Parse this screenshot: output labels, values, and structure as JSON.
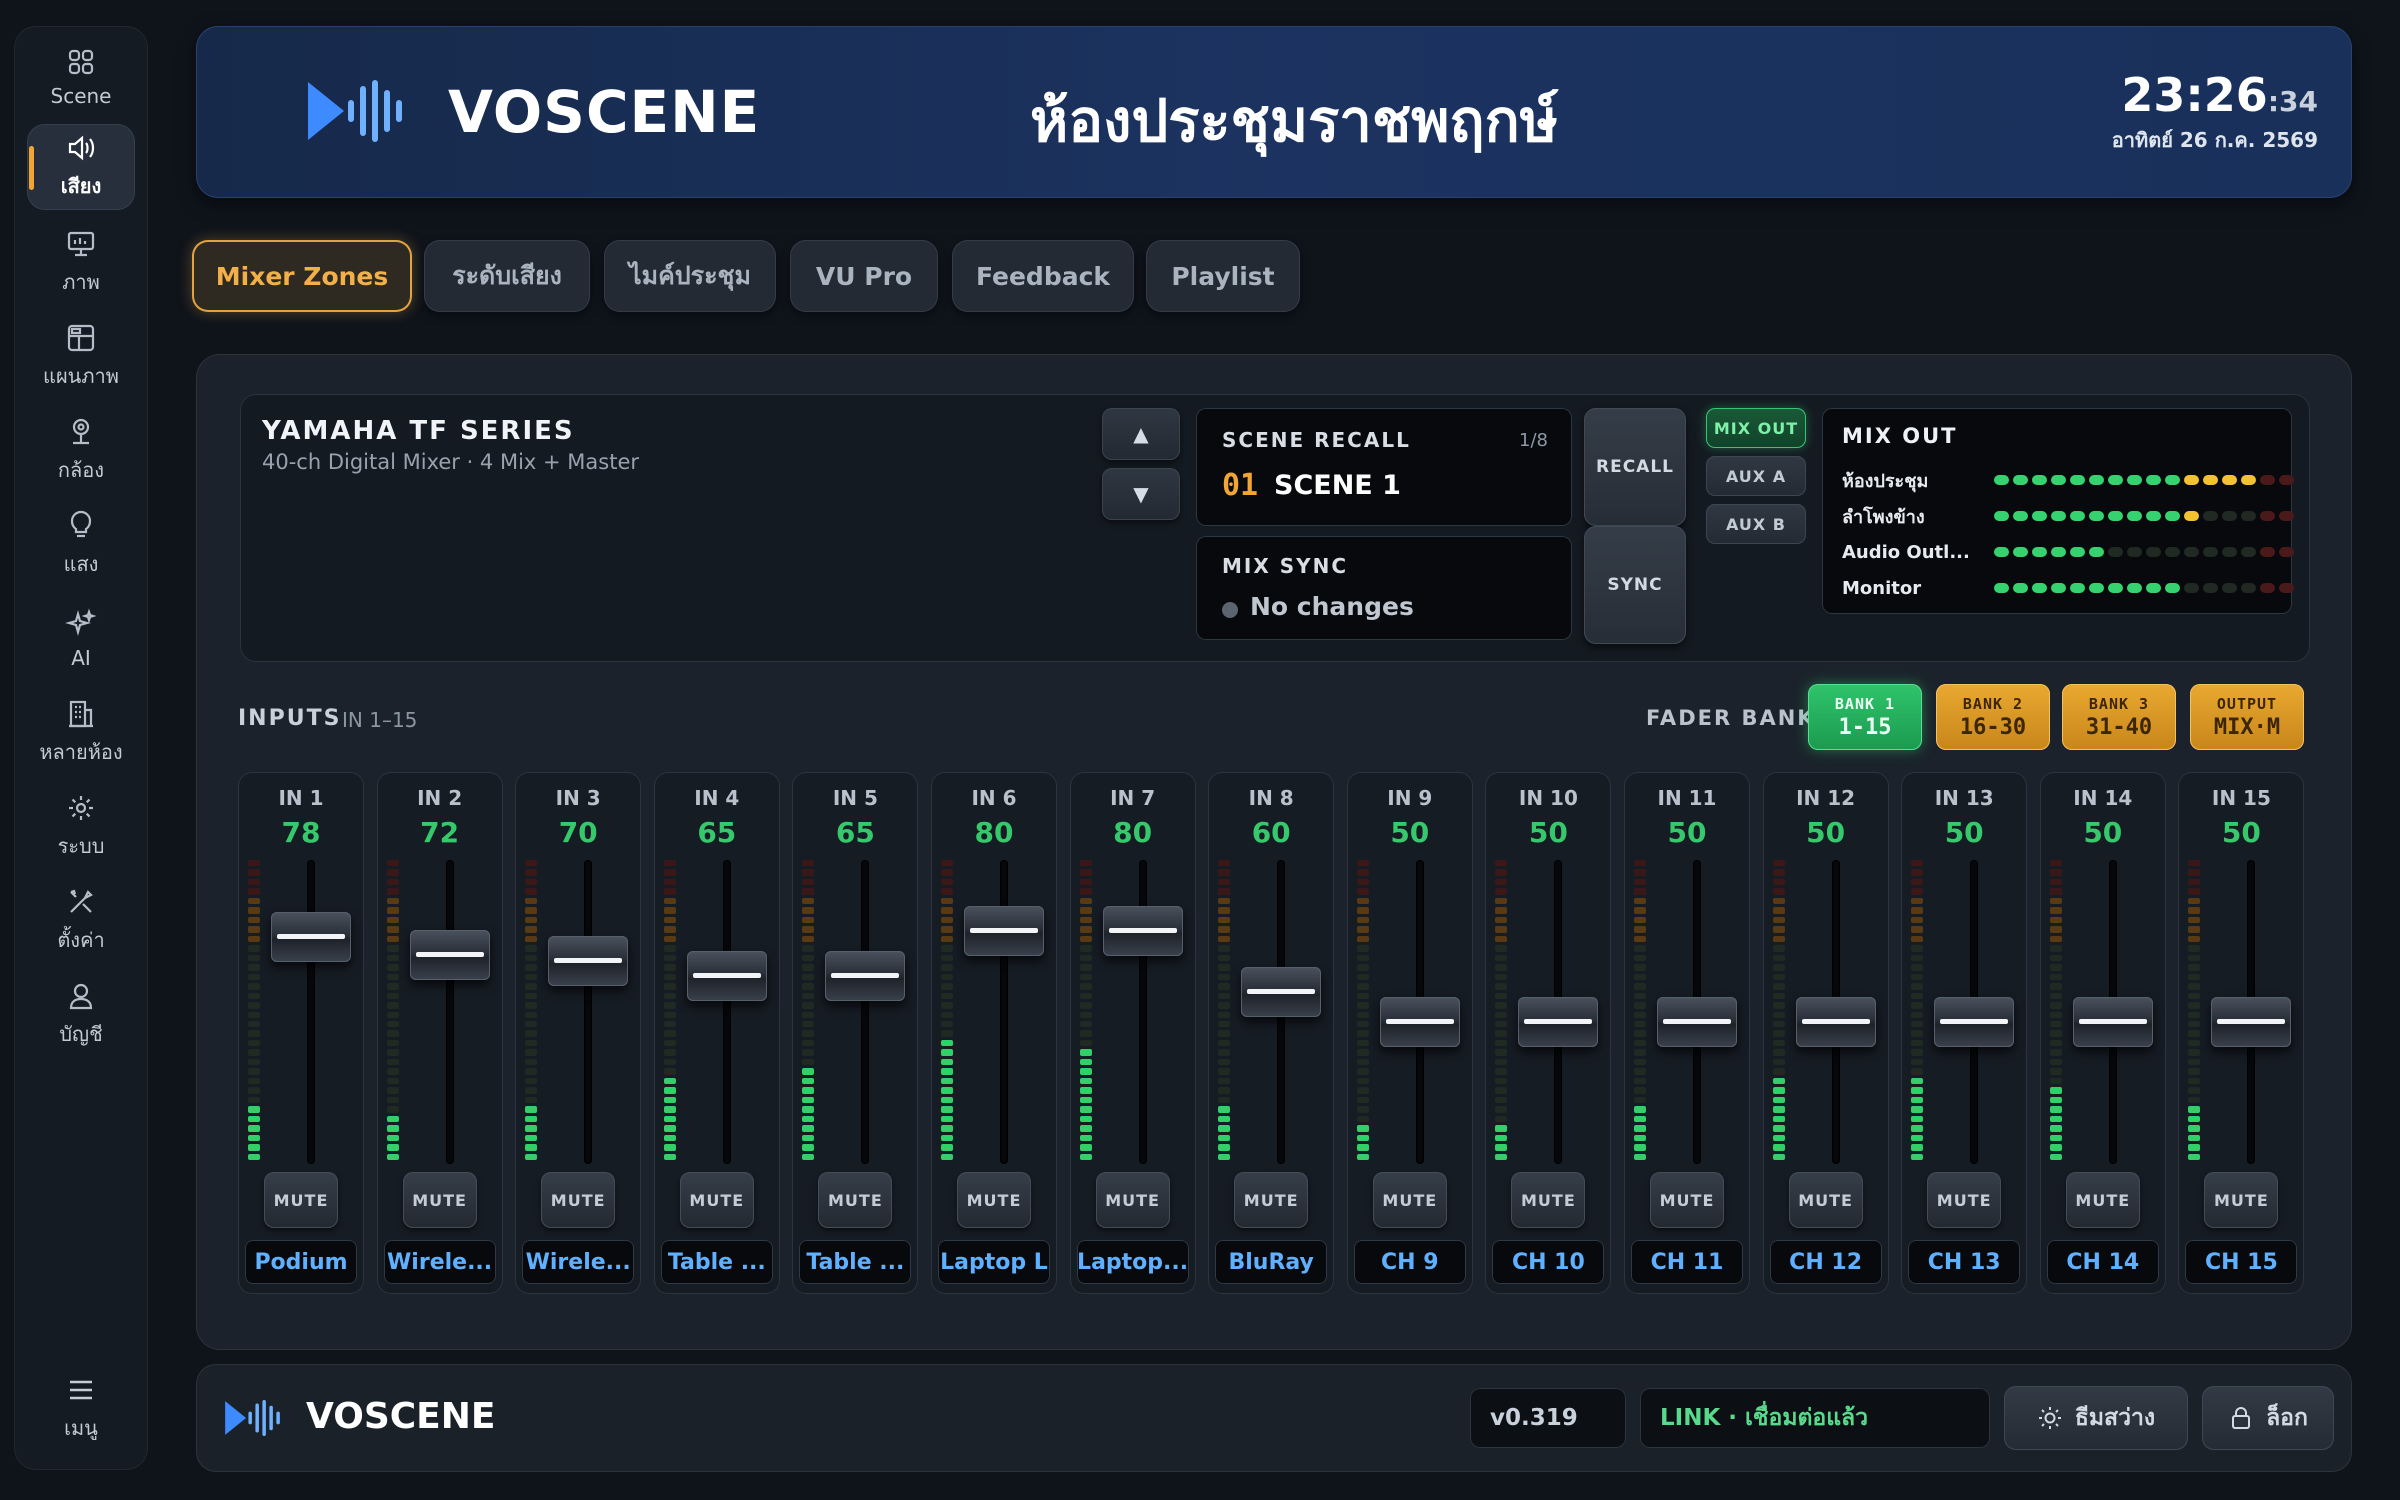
{
  "sidebar": {
    "items": [
      {
        "label": "Scene",
        "icon": "grid-icon",
        "active": false
      },
      {
        "label": "เสียง",
        "icon": "speaker-icon",
        "active": true
      },
      {
        "label": "ภาพ",
        "icon": "monitor-icon",
        "active": false
      },
      {
        "label": "แผนภาพ",
        "icon": "layout-icon",
        "active": false
      },
      {
        "label": "กล้อง",
        "icon": "camera-icon",
        "active": false
      },
      {
        "label": "แสง",
        "icon": "bulb-icon",
        "active": false
      },
      {
        "label": "AI",
        "icon": "sparkle-icon",
        "active": false
      },
      {
        "label": "หลายห้อง",
        "icon": "building-icon",
        "active": false
      },
      {
        "label": "ระบบ",
        "icon": "gear-icon",
        "active": false
      },
      {
        "label": "ตั้งค่า",
        "icon": "tools-icon",
        "active": false
      },
      {
        "label": "บัญชี",
        "icon": "user-icon",
        "active": false
      }
    ],
    "menu_label": "เมนู"
  },
  "header": {
    "brand": "VOSCENE",
    "room_title": "ห้องประชุมราชพฤกษ์",
    "time": "23:26",
    "seconds": ":34",
    "date": "อาทิตย์ 26 ก.ค. 2569"
  },
  "tabs": [
    {
      "label": "Mixer Zones",
      "active": true
    },
    {
      "label": "ระดับเสียง",
      "active": false
    },
    {
      "label": "ไมค์ประชุม",
      "active": false
    },
    {
      "label": "VU Pro",
      "active": false
    },
    {
      "label": "Feedback",
      "active": false
    },
    {
      "label": "Playlist",
      "active": false
    }
  ],
  "mixer": {
    "name": "YAMAHA TF SERIES",
    "subtitle": "40-ch Digital Mixer · 4 Mix + Master",
    "scene_recall": {
      "caption": "SCENE RECALL",
      "counter": "1/8",
      "number": "01",
      "name": "SCENE 1"
    },
    "mix_sync": {
      "caption": "MIX SYNC",
      "status": "No changes"
    },
    "recall_label": "RECALL",
    "sync_label": "SYNC",
    "up_label": "▲",
    "down_label": "▼",
    "out_buttons": [
      {
        "label": "MIX OUT",
        "active": true
      },
      {
        "label": "AUX A",
        "active": false
      },
      {
        "label": "AUX B",
        "active": false
      }
    ],
    "mix_out": {
      "caption": "MIX OUT",
      "rows": [
        {
          "name": "ห้องประชุม",
          "green": 10,
          "yellow": 4
        },
        {
          "name": "ลำโพงข้าง",
          "green": 10,
          "yellow": 1
        },
        {
          "name": "Audio Outl...",
          "green": 6,
          "yellow": 0
        },
        {
          "name": "Monitor",
          "green": 10,
          "yellow": 0
        }
      ]
    }
  },
  "inputs": {
    "caption": "INPUTS",
    "range": "IN 1–15",
    "fader_bank_label": "FADER BANK",
    "banks": [
      {
        "top": "BANK 1",
        "bottom": "1-15",
        "style": "green"
      },
      {
        "top": "BANK 2",
        "bottom": "16-30",
        "style": "amber"
      },
      {
        "top": "BANK 3",
        "bottom": "31-40",
        "style": "amber"
      },
      {
        "top": "OUTPUT",
        "bottom": "MIX·M",
        "style": "amber"
      }
    ],
    "mute_label": "MUTE",
    "channels": [
      {
        "id": "IN 1",
        "value": 78,
        "label": "Podium",
        "meter": 6
      },
      {
        "id": "IN 2",
        "value": 72,
        "label": "Wirele...",
        "meter": 5
      },
      {
        "id": "IN 3",
        "value": 70,
        "label": "Wirele...",
        "meter": 6
      },
      {
        "id": "IN 4",
        "value": 65,
        "label": "Table ...",
        "meter": 9
      },
      {
        "id": "IN 5",
        "value": 65,
        "label": "Table ...",
        "meter": 10
      },
      {
        "id": "IN 6",
        "value": 80,
        "label": "Laptop L",
        "meter": 13
      },
      {
        "id": "IN 7",
        "value": 80,
        "label": "Laptop...",
        "meter": 12
      },
      {
        "id": "IN 8",
        "value": 60,
        "label": "BluRay",
        "meter": 6
      },
      {
        "id": "IN 9",
        "value": 50,
        "label": "CH 9",
        "meter": 4
      },
      {
        "id": "IN 10",
        "value": 50,
        "label": "CH 10",
        "meter": 4
      },
      {
        "id": "IN 11",
        "value": 50,
        "label": "CH 11",
        "meter": 6
      },
      {
        "id": "IN 12",
        "value": 50,
        "label": "CH 12",
        "meter": 9
      },
      {
        "id": "IN 13",
        "value": 50,
        "label": "CH 13",
        "meter": 9
      },
      {
        "id": "IN 14",
        "value": 50,
        "label": "CH 14",
        "meter": 8
      },
      {
        "id": "IN 15",
        "value": 50,
        "label": "CH 15",
        "meter": 6
      }
    ]
  },
  "footer": {
    "brand": "VOSCENE",
    "version": "v0.319",
    "link_status": "LINK · เชื่อมต่อแล้ว",
    "theme_label": "ธีมสว่าง",
    "lock_label": "ล็อก"
  }
}
